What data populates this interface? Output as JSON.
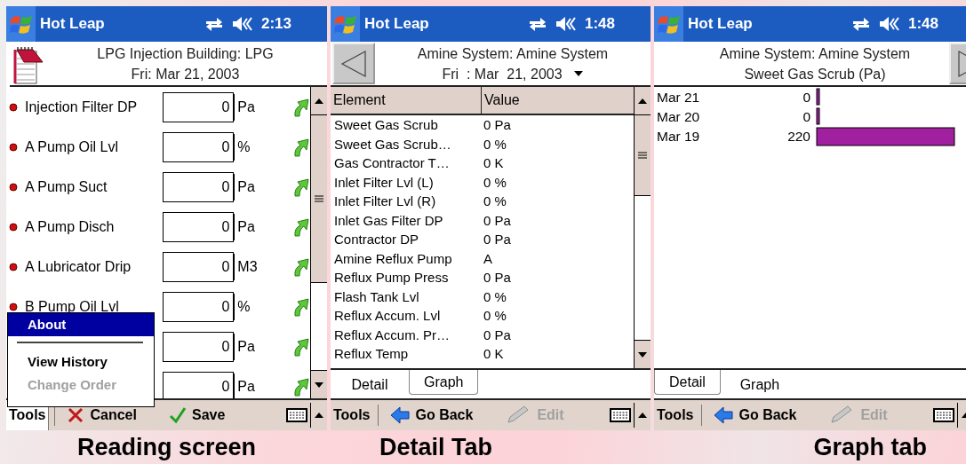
{
  "screens": [
    {
      "kind": "reading",
      "caption": "Reading screen",
      "title_bar": {
        "app": "Hot Leap",
        "time": "2:13"
      },
      "header": {
        "kind": "notepad",
        "title": "LPG Injection Building: LPG",
        "subtitle": "Fri: Mar 21, 2003"
      },
      "readings": [
        {
          "label": "Injection Filter DP",
          "value": "0",
          "unit": "Pa"
        },
        {
          "label": "A Pump Oil Lvl",
          "value": "0",
          "unit": "%"
        },
        {
          "label": "A Pump Suct",
          "value": "0",
          "unit": "Pa"
        },
        {
          "label": "A Pump Disch",
          "value": "0",
          "unit": "Pa"
        },
        {
          "label": "A Lubricator Drip",
          "value": "0",
          "unit": "M3"
        },
        {
          "label": "B Pump Oil Lvl",
          "value": "0",
          "unit": "%"
        },
        {
          "value": "0",
          "unit": "Pa"
        },
        {
          "value": "0",
          "unit": "Pa"
        }
      ],
      "menu": {
        "items": [
          {
            "kind": "item",
            "label": "About",
            "selected": true,
            "disabled": false
          },
          {
            "kind": "separator"
          },
          {
            "kind": "item",
            "label": "View History",
            "selected": false,
            "disabled": false
          },
          {
            "kind": "item",
            "label": "Change Order",
            "selected": false,
            "disabled": true
          }
        ]
      },
      "menu_bar": [
        {
          "kind": "tools",
          "label": "Tools",
          "open": true
        },
        {
          "kind": "cancel",
          "label": "Cancel",
          "disabled": false
        },
        {
          "kind": "save",
          "label": "Save",
          "disabled": false
        }
      ]
    },
    {
      "kind": "detail",
      "caption": "Detail Tab",
      "title_bar": {
        "app": "Hot Leap",
        "time": "1:48"
      },
      "header": {
        "kind": "back",
        "title": "Amine System: Amine System",
        "subtitle": "Fri  : Mar  21, 2003",
        "dropdown": true
      },
      "table": {
        "columns": [
          "Element",
          "Value"
        ],
        "rows": [
          [
            "Sweet Gas Scrub",
            "0 Pa"
          ],
          [
            "Sweet Gas Scrub…",
            "0 %"
          ],
          [
            "Gas Contractor T…",
            "0 K"
          ],
          [
            "Inlet Filter Lvl (L)",
            "0 %"
          ],
          [
            "Inlet Filter Lvl (R)",
            "0 %"
          ],
          [
            "Inlet Gas Filter DP",
            "0 Pa"
          ],
          [
            "Contractor DP",
            "0 Pa"
          ],
          [
            "Amine Reflux Pump",
            "A"
          ],
          [
            "Reflux Pump Press",
            "0 Pa"
          ],
          [
            "Flash Tank Lvl",
            "0 %"
          ],
          [
            "Reflux Accum. Lvl",
            "0 %"
          ],
          [
            "Reflux Accum. Pr…",
            "0 Pa"
          ],
          [
            "Reflux Temp",
            "0 K"
          ]
        ]
      },
      "tabs": [
        {
          "label": "Detail",
          "selected": true
        },
        {
          "label": "Graph",
          "selected": false
        }
      ],
      "menu_bar": [
        {
          "kind": "tools",
          "label": "Tools",
          "open": false
        },
        {
          "kind": "back",
          "label": "Go Back",
          "disabled": false
        },
        {
          "kind": "edit",
          "label": "Edit",
          "disabled": true
        }
      ]
    },
    {
      "kind": "graph",
      "caption": "Graph tab",
      "title_bar": {
        "app": "Hot Leap",
        "time": "1:48"
      },
      "header": {
        "kind": "forward",
        "title": "Amine System: Amine System",
        "subtitle": "Sweet Gas Scrub (Pa)"
      },
      "chart_data": {
        "type": "bar",
        "orientation": "horizontal",
        "categories": [
          "Mar 21",
          "Mar 20",
          "Mar 19"
        ],
        "series": [
          {
            "color": "#a020a0",
            "values": [
              0,
              0,
              220
            ]
          }
        ],
        "data_labels": true
      },
      "tabs": [
        {
          "label": "Detail",
          "selected": false
        },
        {
          "label": "Graph",
          "selected": true
        }
      ],
      "menu_bar": [
        {
          "kind": "tools",
          "label": "Tools",
          "open": false
        },
        {
          "kind": "back",
          "label": "Go Back",
          "disabled": false
        },
        {
          "kind": "edit",
          "label": "Edit",
          "disabled": true
        }
      ]
    }
  ]
}
